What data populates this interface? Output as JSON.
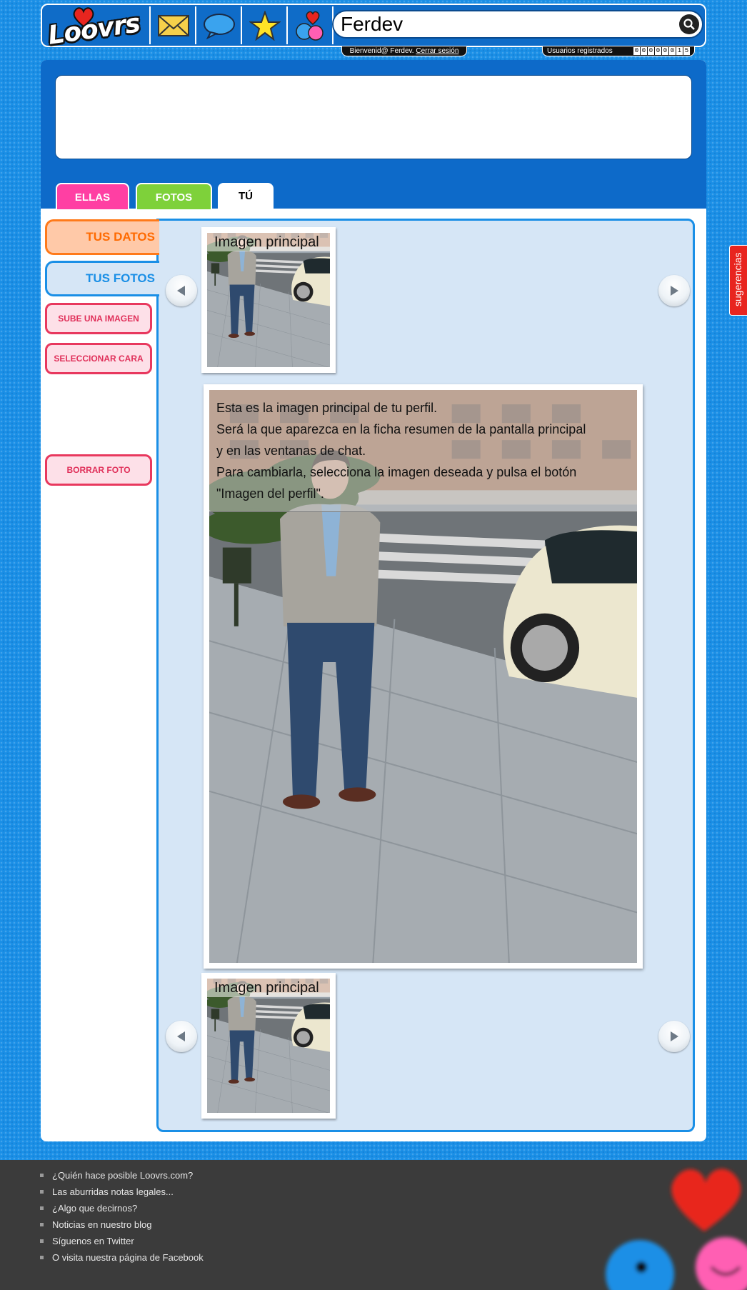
{
  "header": {
    "logo_text": "Loovrs",
    "nav_icons": [
      "envelope-icon",
      "speech-bubble-icon",
      "star-icon",
      "couple-hearts-icon"
    ],
    "search_value": "Ferdev",
    "welcome_text": "Bienvenid@  Ferdev.",
    "logout_label": "Cerrar sesión",
    "users_label": "Usuarios registrados",
    "users_count_digits": [
      "0",
      "0",
      "0",
      "0",
      "0",
      "0",
      "1",
      "5"
    ]
  },
  "tabs": [
    {
      "label": "ELLAS",
      "color": "#ff3fa3"
    },
    {
      "label": "FOTOS",
      "color": "#7ed13a"
    },
    {
      "label": "TÚ",
      "color": "#ffffff"
    }
  ],
  "sidebar": {
    "tus_datos": "TUS DATOS",
    "tus_fotos": "TUS FOTOS",
    "sube_imagen": "SUBE UNA IMAGEN",
    "seleccionar_cara": "SELECCIONAR CARA",
    "borrar_foto": "BORRAR FOTO"
  },
  "gallery": {
    "thumb_caption": "Imagen principal",
    "big_caption_lines": [
      "Esta es la imagen principal de tu perfil.",
      "Será la que aparezca en la ficha resumen de la pantalla principal",
      "y en las ventanas de chat.",
      "Para cambiarla, selecciona la imagen deseada y pulsa el botón",
      "\"Imagen del perfil\"."
    ]
  },
  "sugerencias_label": "sugerencias",
  "footer": {
    "links": [
      "¿Quién hace posible Loovrs.com?",
      "Las aburridas notas legales...",
      "¿Algo que decirnos?",
      "Noticias en nuestro blog",
      "Síguenos en Twitter",
      "O visita nuestra página de Facebook"
    ]
  },
  "colors": {
    "page_bg": "#1a8fe6",
    "panel_blue": "#0d6ac9",
    "orange": "#ff6a00",
    "pink": "#e8385e",
    "content_bg": "#d6e6f6"
  }
}
